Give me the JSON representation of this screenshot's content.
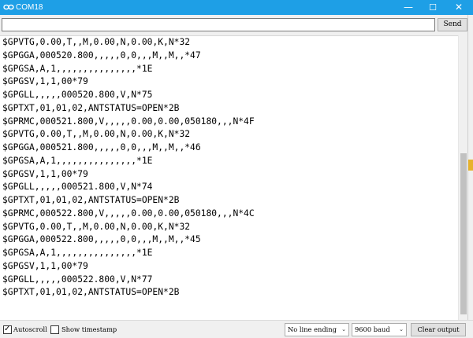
{
  "window": {
    "title": "COM18",
    "minimize_glyph": "—",
    "maximize_glyph": "☐",
    "close_glyph": "✕",
    "icon": "infinity-icon",
    "accent_color": "#1e9fe6"
  },
  "sendbar": {
    "input_value": "",
    "send_label": "Send"
  },
  "output": {
    "lines": [
      "$GPVTG,0.00,T,,M,0.00,N,0.00,K,N*32",
      "$GPGGA,000520.800,,,,,0,0,,,M,,M,,*47",
      "$GPGSA,A,1,,,,,,,,,,,,,,,*1E",
      "$GPGSV,1,1,00*79",
      "$GPGLL,,,,,000520.800,V,N*75",
      "$GPTXT,01,01,02,ANTSTATUS=OPEN*2B",
      "$GPRMC,000521.800,V,,,,,0.00,0.00,050180,,,N*4F",
      "$GPVTG,0.00,T,,M,0.00,N,0.00,K,N*32",
      "$GPGGA,000521.800,,,,,0,0,,,M,,M,,*46",
      "$GPGSA,A,1,,,,,,,,,,,,,,,*1E",
      "$GPGSV,1,1,00*79",
      "$GPGLL,,,,,000521.800,V,N*74",
      "$GPTXT,01,01,02,ANTSTATUS=OPEN*2B",
      "$GPRMC,000522.800,V,,,,,0.00,0.00,050180,,,N*4C",
      "$GPVTG,0.00,T,,M,0.00,N,0.00,K,N*32",
      "$GPGGA,000522.800,,,,,0,0,,,M,,M,,*45",
      "$GPGSA,A,1,,,,,,,,,,,,,,,*1E",
      "$GPGSV,1,1,00*79",
      "$GPGLL,,,,,000522.800,V,N*77",
      "$GPTXT,01,01,02,ANTSTATUS=OPEN*2B"
    ]
  },
  "footer": {
    "autoscroll_label": "Autoscroll",
    "autoscroll_checked": true,
    "timestamp_label": "Show timestamp",
    "timestamp_checked": false,
    "line_ending_value": "No line ending",
    "baud_value": "9600 baud",
    "clear_label": "Clear output",
    "dropdown_arrow": "⌄",
    "checkmark": "✓"
  }
}
